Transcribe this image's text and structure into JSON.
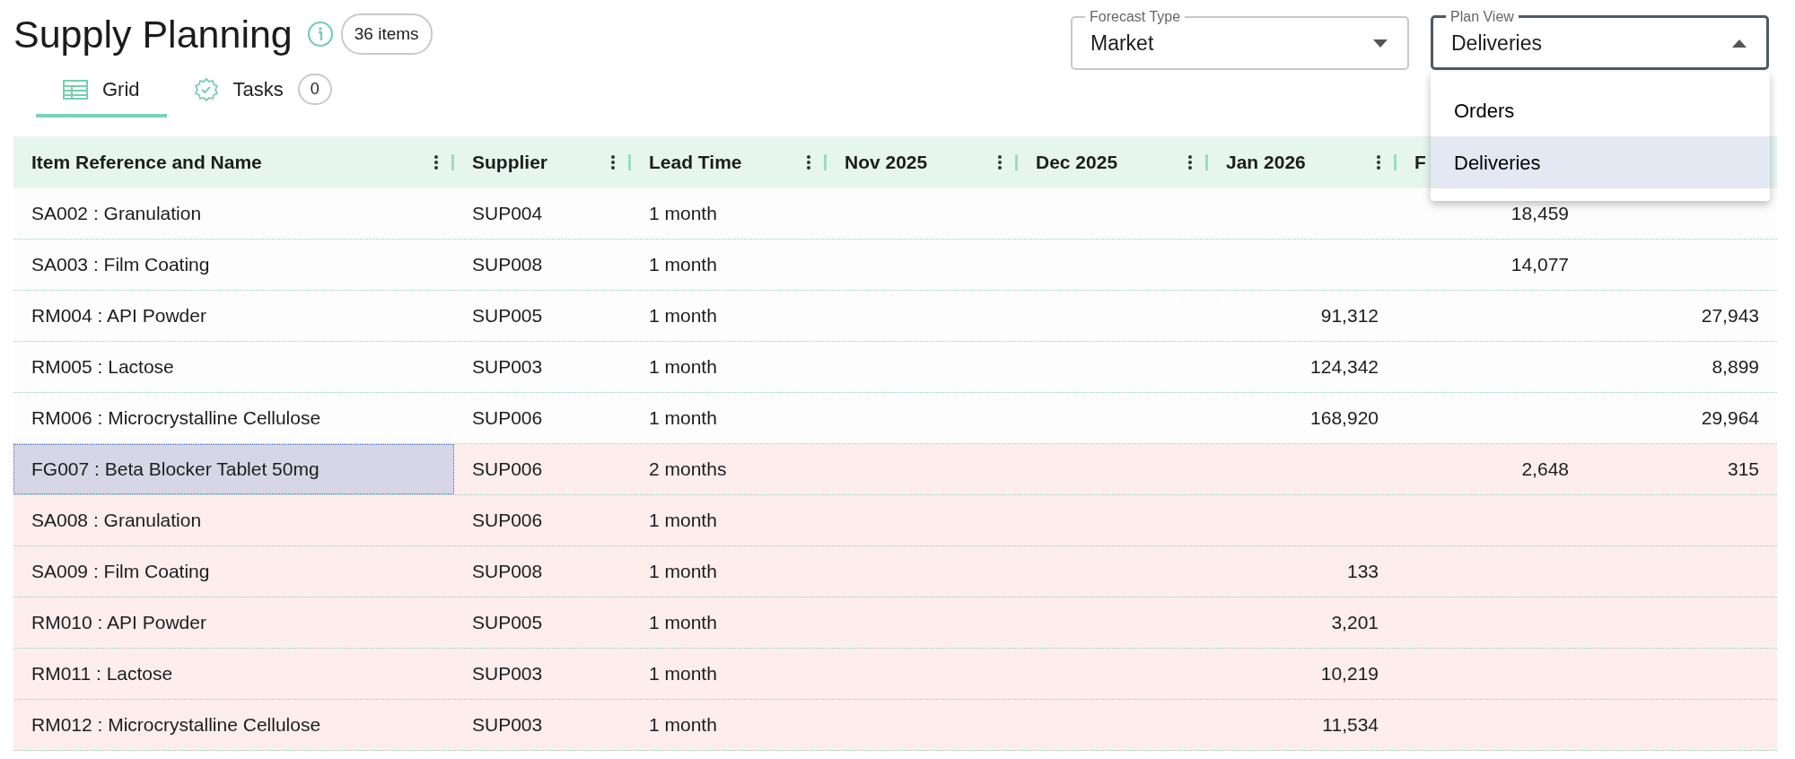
{
  "page": {
    "title": "Supply Planning",
    "count_badge": "36 items"
  },
  "tabs": [
    {
      "label": "Grid",
      "kind": "grid",
      "selected": true
    },
    {
      "label": "Tasks",
      "kind": "tasks",
      "count": "0",
      "selected": false
    }
  ],
  "filters": [
    {
      "label": "Forecast Type",
      "value": "Market",
      "open": false
    },
    {
      "label": "Plan View",
      "value": "Deliveries",
      "open": true,
      "options": [
        {
          "label": "Orders",
          "selected": false
        },
        {
          "label": "Deliveries",
          "selected": true
        }
      ]
    }
  ],
  "table": {
    "columns": [
      "Item Reference and Name",
      "Supplier",
      "Lead Time",
      "Nov 2025",
      "Dec 2025",
      "Jan 2026",
      "F",
      null
    ],
    "rows": [
      {
        "cells": [
          "SA002 : Granulation",
          "SUP004",
          "1 month",
          null,
          null,
          null,
          "18,459",
          null
        ],
        "flagged": false,
        "focused": false
      },
      {
        "cells": [
          "SA003 : Film Coating",
          "SUP008",
          "1 month",
          null,
          null,
          null,
          "14,077",
          null
        ],
        "flagged": false,
        "focused": false
      },
      {
        "cells": [
          "RM004 : API Powder",
          "SUP005",
          "1 month",
          null,
          null,
          "91,312",
          null,
          "27,943"
        ],
        "flagged": false,
        "focused": false
      },
      {
        "cells": [
          "RM005 : Lactose",
          "SUP003",
          "1 month",
          null,
          null,
          "124,342",
          null,
          "8,899"
        ],
        "flagged": false,
        "focused": false
      },
      {
        "cells": [
          "RM006 : Microcrystalline Cellulose",
          "SUP006",
          "1 month",
          null,
          null,
          "168,920",
          null,
          "29,964"
        ],
        "flagged": false,
        "focused": false
      },
      {
        "cells": [
          "FG007 : Beta Blocker Tablet 50mg",
          "SUP006",
          "2 months",
          null,
          null,
          null,
          "2,648",
          "315"
        ],
        "flagged": true,
        "focused": true
      },
      {
        "cells": [
          "SA008 : Granulation",
          "SUP006",
          "1 month",
          null,
          null,
          null,
          null,
          null
        ],
        "flagged": true,
        "focused": false
      },
      {
        "cells": [
          "SA009 : Film Coating",
          "SUP008",
          "1 month",
          null,
          null,
          "133",
          null,
          null
        ],
        "flagged": true,
        "focused": false
      },
      {
        "cells": [
          "RM010 : API Powder",
          "SUP005",
          "1 month",
          null,
          null,
          "3,201",
          null,
          null
        ],
        "flagged": true,
        "focused": false
      },
      {
        "cells": [
          "RM011 : Lactose",
          "SUP003",
          "1 month",
          null,
          null,
          "10,219",
          null,
          null
        ],
        "flagged": true,
        "focused": false
      },
      {
        "cells": [
          "RM012 : Microcrystalline Cellulose",
          "SUP003",
          "1 month",
          null,
          null,
          "11,534",
          null,
          null
        ],
        "flagged": true,
        "focused": false
      }
    ]
  }
}
